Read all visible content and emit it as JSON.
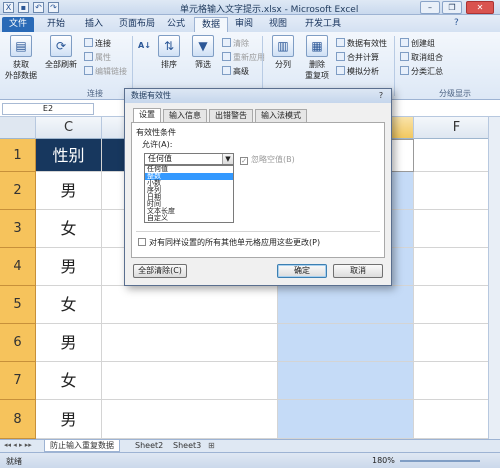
{
  "window": {
    "title": "单元格输入文字提示.xlsx - Microsoft Excel",
    "minimize": "–",
    "restore": "❐",
    "close": "✕"
  },
  "quick_access": [
    "save-icon",
    "undo-icon",
    "redo-icon"
  ],
  "ribbon_tabs": [
    "文件",
    "开始",
    "插入",
    "页面布局",
    "公式",
    "数据",
    "审阅",
    "视图",
    "开发工具"
  ],
  "ribbon": {
    "get_external": "获取\n外部数据",
    "refresh_all": "全部刷新",
    "connections_small": [
      "连接",
      "属性",
      "编辑链接"
    ],
    "group_connections": "连接",
    "sort_asc": "A↓",
    "sort": "排序",
    "filter": "筛选",
    "filter_small": [
      "清除",
      "重新应用",
      "高级"
    ],
    "text_to_columns": "分列",
    "remove_duplicates": "删除\n重复项",
    "data_tools_small": [
      "数据有效性",
      "合并计算",
      "模拟分析"
    ],
    "outline_small": [
      "创建组",
      "取消组合",
      "分类汇总"
    ],
    "group_outline": "分级显示"
  },
  "formula_bar": {
    "name_box": "E2"
  },
  "columns": [
    "C",
    "D",
    "E",
    "F"
  ],
  "rows": [
    "1",
    "2",
    "3",
    "4",
    "5",
    "6",
    "7",
    "8"
  ],
  "cells": {
    "header": "性别",
    "values": [
      "男",
      "女",
      "男",
      "女",
      "男",
      "女",
      "男"
    ]
  },
  "sheet_tabs": [
    "防止输入重复数据",
    "Sheet2",
    "Sheet3"
  ],
  "status": {
    "ready": "就绪",
    "zoom": "180%"
  },
  "dialog": {
    "title": "数据有效性",
    "tabs": [
      "设置",
      "输入信息",
      "出错警告",
      "输入法模式"
    ],
    "criteria_label": "有效性条件",
    "allow_label": "允许(A):",
    "allow_value": "任何值",
    "ignore_blank": "忽略空值(B)",
    "options": [
      "任何值",
      "整数",
      "小数",
      "序列",
      "日期",
      "时间",
      "文本长度",
      "自定义"
    ],
    "highlighted_option": "整数",
    "apply_all": "对有同样设置的所有其他单元格应用这些更改(P)",
    "clear_all": "全部清除(C)",
    "ok": "确定",
    "cancel": "取消"
  },
  "colors": {
    "accent": "#2a6ab7",
    "header_cell": "#17375e",
    "row_header": "#f6c35c",
    "selection": "#c5dbf7",
    "annotation": "#e8303a"
  }
}
